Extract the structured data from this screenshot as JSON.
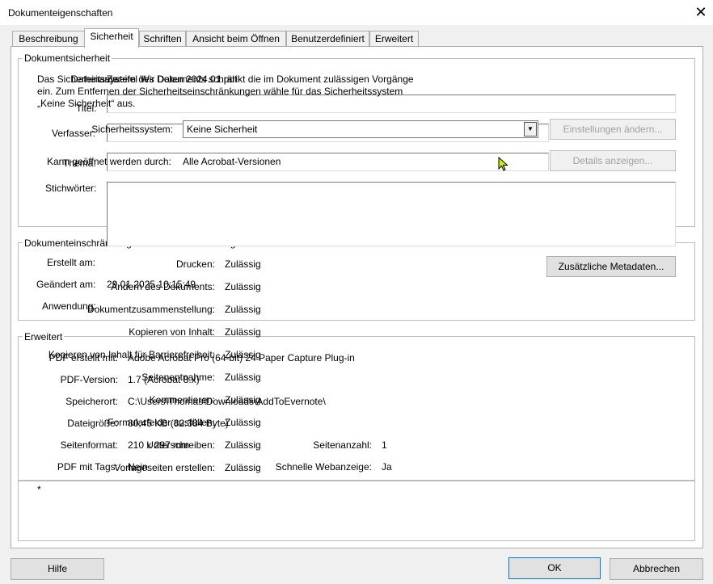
{
  "window": {
    "title": "Dokumenteigenschaften"
  },
  "tabs": [
    {
      "label": "Beschreibung"
    },
    {
      "label": "Sicherheit"
    },
    {
      "label": "Schriften"
    },
    {
      "label": "Ansicht beim Öffnen"
    },
    {
      "label": "Benutzerdefiniert"
    },
    {
      "label": "Erweitert"
    }
  ],
  "security": {
    "group_label": "Dokumentsicherheit",
    "desc_line1": "Das Sicherheitssystem des Dokuments schränkt die im Dokument zulässigen Vorgänge",
    "desc_line2": "ein. Zum Entfernen der Sicherheitseinschränkungen wähle für das Sicherheitssystem",
    "desc_line3": "„Keine Sicherheit“ aus.",
    "system_label": "Sicherheitssystem:",
    "system_value": "Keine Sicherheit",
    "settings_button": "Einstellungen ändern...",
    "opened_by_label": "Kann geöffnet werden durch:",
    "opened_by_value": "Alle Acrobat-Versionen",
    "details_button": "Details anzeigen..."
  },
  "description_overlay": {
    "dateiname_label": "Dateiname:",
    "dateiname_value": "Zweifel Wir Daten 2024.01.pdf",
    "titel_label": "Titel:",
    "verfasser_label": "Verfasser:",
    "thema_label": "Thema:",
    "stichwoerter_label": "Stichwörter:",
    "erstellt_label": "Erstellt am:",
    "geaendert_label": "Geändert am:",
    "geaendert_value": "29.01.2025 10:15:49",
    "anwendung_label": "Anwendung:",
    "metadata_button": "Zusätzliche Metadaten..."
  },
  "restrictions": {
    "group_label": "Dokumenteinschränkungen – Zusammenfassung",
    "items": [
      {
        "label": "Drucken:",
        "value": "Zulässig"
      },
      {
        "label": "Ändern des Dokuments:",
        "value": "Zulässig"
      },
      {
        "label": "Dokumentzusammenstellung:",
        "value": "Zulässig"
      },
      {
        "label": "Kopieren von Inhalt:",
        "value": "Zulässig"
      },
      {
        "label": "Kopieren von Inhalt für Barrierefreiheit:",
        "value": "Zulässig"
      },
      {
        "label": "Seitenentnahme:",
        "value": "Zulässig"
      },
      {
        "label": "Kommentieren:",
        "value": "Zulässig"
      },
      {
        "label": "Formularfelder ausfüllen:",
        "value": "Zulässig"
      },
      {
        "label": "Unterschreiben:",
        "value": "Zulässig"
      },
      {
        "label": "Vorlageseiten erstellen:",
        "value": "Zulässig"
      }
    ]
  },
  "advanced": {
    "group_label": "Erweitert",
    "pdf_creator_label": "PDF erstellt mit:",
    "pdf_creator_value": "Adobe Acrobat Pro (64-bit) 24 Paper Capture Plug-in",
    "pdf_version_label": "PDF-Version:",
    "pdf_version_value": "1.7 (Acrobat 8.x)",
    "location_label": "Speicherort:",
    "location_value": "C:\\Users\\Thomas\\Downloads\\AddToEvernote\\",
    "size_label": "Dateigröße:",
    "size_value": "80,45 KB (82.384 Byte)",
    "format_label": "Seitenformat:",
    "format_value": "210 x 297 mm",
    "pagecount_label": "Seitenanzahl:",
    "pagecount_value": "1",
    "tagged_label": "PDF mit Tags:",
    "tagged_value": "Nein",
    "webview_label": "Schnelle Webanzeige:",
    "webview_value": "Ja",
    "footnote": "*"
  },
  "footer": {
    "help_button": "Hilfe",
    "ok_button": "OK",
    "cancel_button": "Abbrechen"
  }
}
